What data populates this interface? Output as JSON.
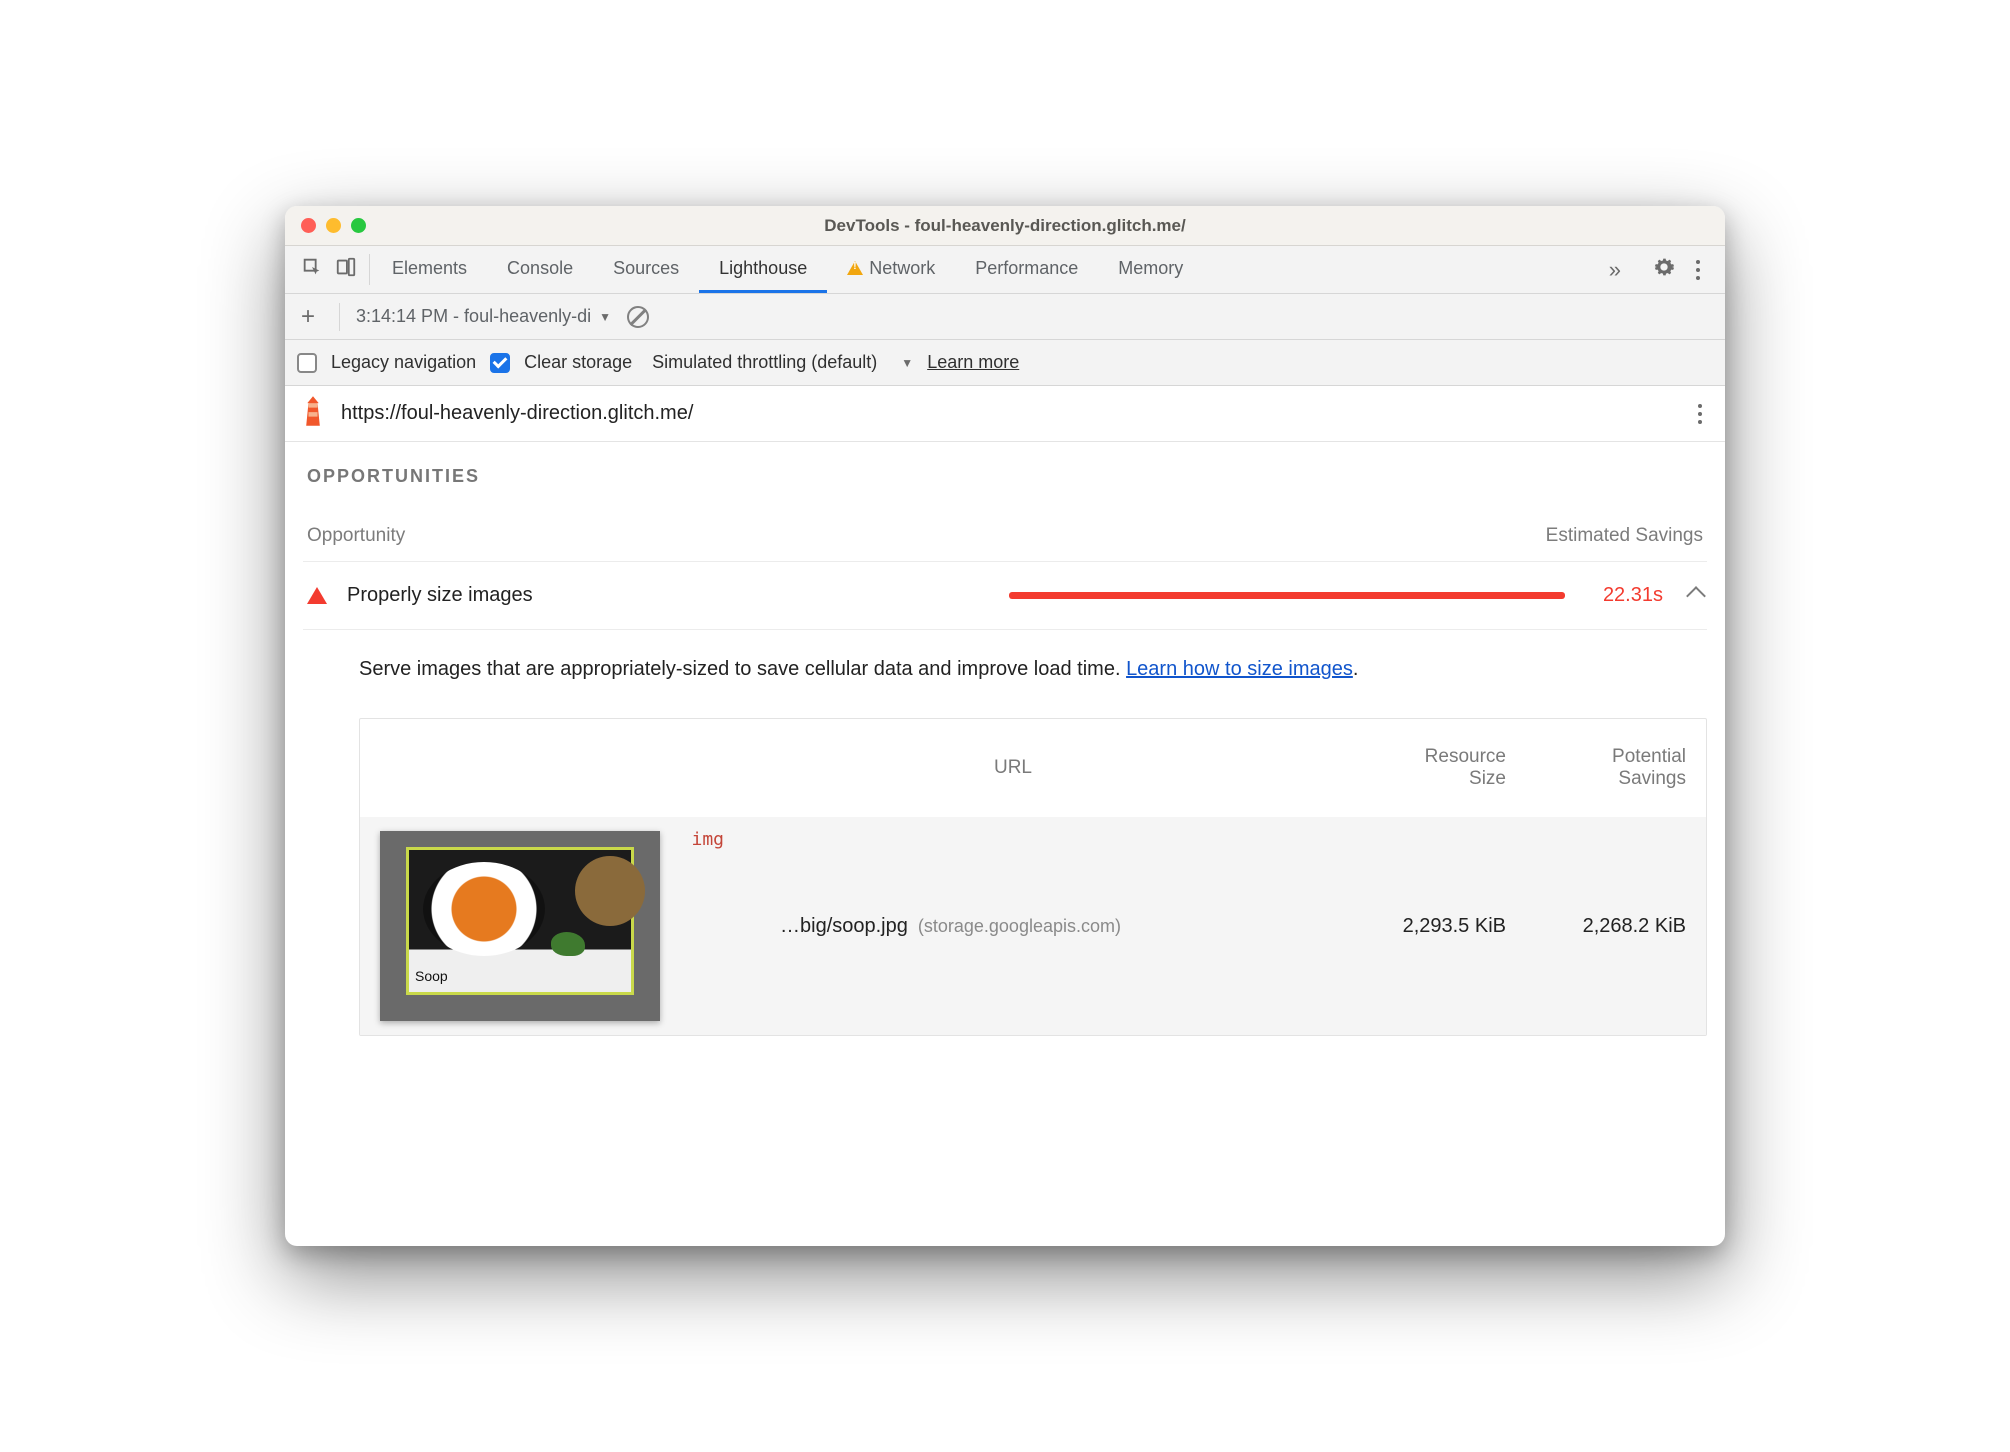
{
  "window": {
    "title": "DevTools - foul-heavenly-direction.glitch.me/"
  },
  "tabs": {
    "items": [
      "Elements",
      "Console",
      "Sources",
      "Lighthouse",
      "Network",
      "Performance",
      "Memory"
    ],
    "active": "Lighthouse",
    "warning_on": "Network"
  },
  "subbar": {
    "report_label": "3:14:14 PM - foul-heavenly-di"
  },
  "options": {
    "legacy_nav_label": "Legacy navigation",
    "legacy_nav_checked": false,
    "clear_storage_label": "Clear storage",
    "clear_storage_checked": true,
    "throttling_label": "Simulated throttling (default)",
    "learn_more_label": "Learn more"
  },
  "report": {
    "url": "https://foul-heavenly-direction.glitch.me/",
    "section_title": "OPPORTUNITIES",
    "header_left": "Opportunity",
    "header_right": "Estimated Savings",
    "opportunity": {
      "title": "Properly size images",
      "savings_time": "22.31s",
      "description_text": "Serve images that are appropriately-sized to save cellular data and improve load time. ",
      "learn_link_text": "Learn how to size images",
      "table": {
        "col_url": "URL",
        "col_resource_l1": "Resource",
        "col_resource_l2": "Size",
        "col_savings_l1": "Potential",
        "col_savings_l2": "Savings",
        "rows": [
          {
            "tag": "img",
            "caption": "Soop",
            "name": "…big/soop.jpg",
            "host": "(storage.googleapis.com)",
            "resource_size": "2,293.5 KiB",
            "potential_savings": "2,268.2 KiB"
          }
        ]
      }
    }
  }
}
